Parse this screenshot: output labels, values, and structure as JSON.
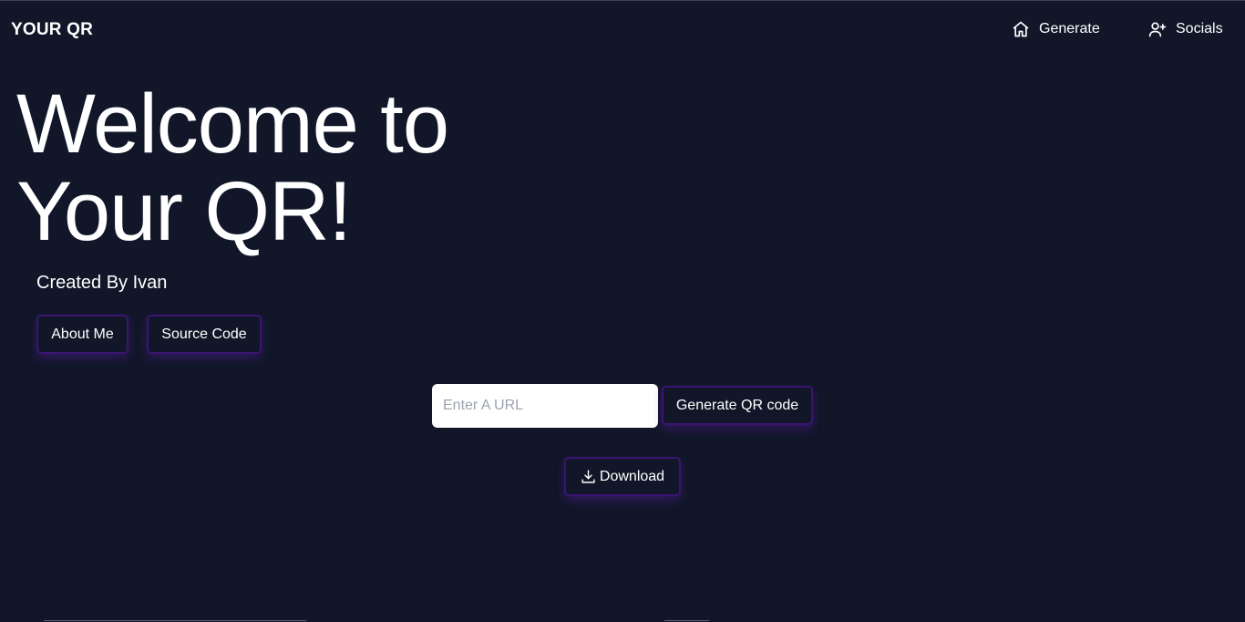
{
  "header": {
    "brand": "YOUR QR",
    "nav": {
      "generate": {
        "label": "Generate",
        "icon": "home-icon"
      },
      "socials": {
        "label": "Socials",
        "icon": "user-plus-icon"
      }
    }
  },
  "hero": {
    "title_line1": "Welcome to",
    "title_line2": "Your QR!",
    "subtitle": "Created By Ivan",
    "buttons": {
      "about": "About Me",
      "source": "Source Code"
    }
  },
  "generator": {
    "input_value": "",
    "input_placeholder": "Enter A URL",
    "generate_label": "Generate QR code",
    "download_label": "Download",
    "download_icon": "download-icon"
  },
  "colors": {
    "background": "#111729",
    "accent_border": "#3b1473",
    "text": "#ffffff"
  }
}
